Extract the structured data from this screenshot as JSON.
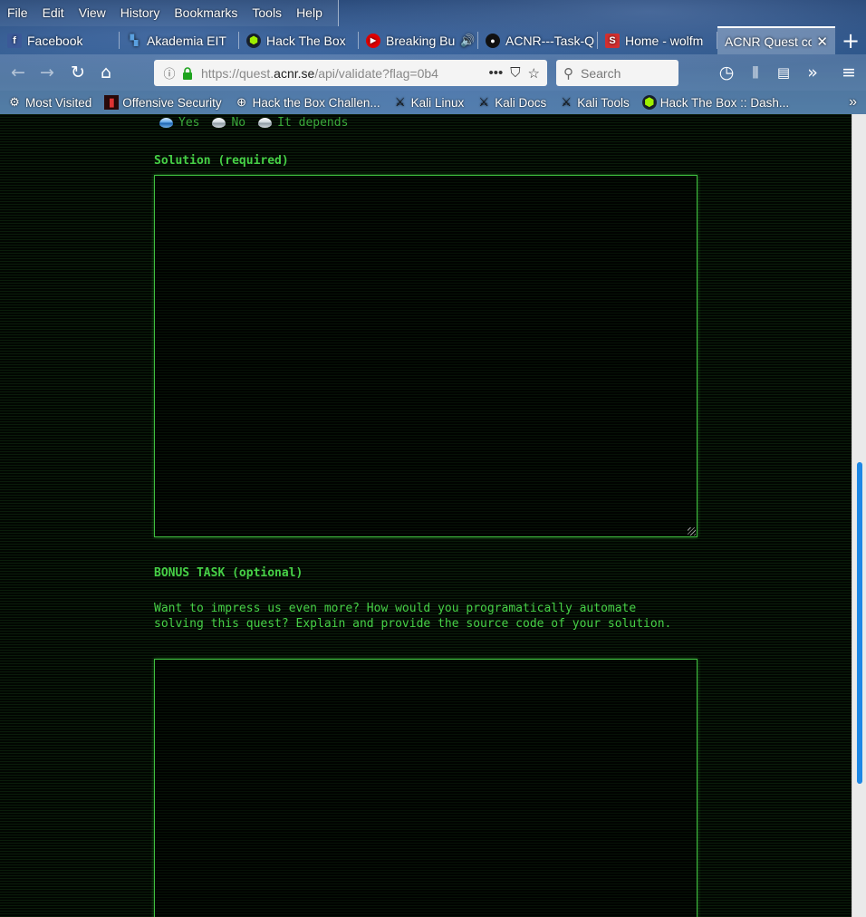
{
  "menubar": [
    "File",
    "Edit",
    "View",
    "History",
    "Bookmarks",
    "Tools",
    "Help"
  ],
  "tabs": [
    {
      "label": "Facebook",
      "icon": "facebook-icon",
      "icon_char": "f",
      "color": "#3b5998"
    },
    {
      "label": "Akademia EIT",
      "icon": "akademia-icon",
      "icon_char": "▚",
      "color": "#2b6fb5"
    },
    {
      "label": "Hack The Box",
      "icon": "htb-icon",
      "icon_char": "⬢",
      "color": "#9fef00"
    },
    {
      "label": "Breaking Bu",
      "icon": "youtube-icon",
      "icon_char": "▶",
      "color": "#e00000"
    },
    {
      "label": "ACNR---Task-Q",
      "icon": "github-icon",
      "icon_char": "●",
      "color": "#111111"
    },
    {
      "label": "Home - wolfm",
      "icon": "s-icon",
      "icon_char": "S",
      "color": "#d32f2f"
    },
    {
      "label": "ACNR Quest co",
      "icon": "page-icon",
      "active": true
    }
  ],
  "url": {
    "prefix": "https://quest.",
    "domain": "acnr.se",
    "path": "/api/validate?flag=0b4"
  },
  "search": {
    "placeholder": "Search"
  },
  "bookmarks": [
    {
      "label": "Most Visited",
      "icon": "gear-icon",
      "icon_char": "⚙"
    },
    {
      "label": "Offensive Security",
      "icon": "offsec-icon",
      "icon_char": "▮"
    },
    {
      "label": "Hack the Box Challen...",
      "icon": "globe-icon",
      "icon_char": "⊕"
    },
    {
      "label": "Kali Linux",
      "icon": "kali-icon",
      "icon_char": "⚔"
    },
    {
      "label": "Kali Docs",
      "icon": "kali-icon",
      "icon_char": "⚔"
    },
    {
      "label": "Kali Tools",
      "icon": "kali-icon",
      "icon_char": "⚔"
    },
    {
      "label": "Hack The Box :: Dash...",
      "icon": "htb-icon",
      "icon_char": "⬢"
    }
  ],
  "page": {
    "radio_options": [
      {
        "label": "Yes",
        "checked": true
      },
      {
        "label": "No",
        "checked": false
      },
      {
        "label": "It depends",
        "checked": false
      }
    ],
    "solution_label": "Solution (required)",
    "solution_value": "",
    "bonus_label": "BONUS TASK (optional)",
    "bonus_description_line1": "Want to impress us even more? How would you programatically automate",
    "bonus_description_line2": "solving this quest? Explain and provide the source code of your solution.",
    "bonus_value": ""
  },
  "colors": {
    "terminal_green": "#46d046",
    "scrollbar_thumb": "#1e88e5"
  }
}
